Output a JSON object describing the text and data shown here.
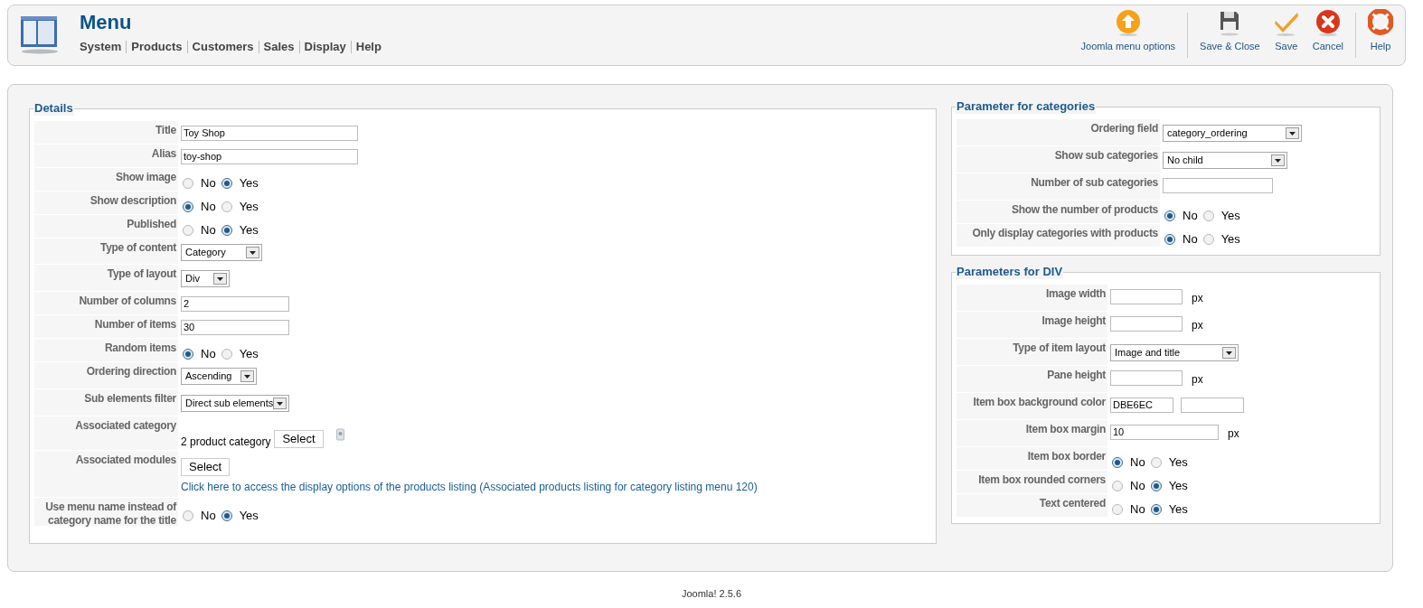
{
  "header": {
    "title": "Menu",
    "menu": [
      "System",
      "Products",
      "Customers",
      "Sales",
      "Display",
      "Help"
    ]
  },
  "toolbar": [
    {
      "kind": "options",
      "label": "Joomla menu options"
    },
    {
      "kind": "save-close",
      "label": "Save & Close"
    },
    {
      "kind": "save",
      "label": "Save"
    },
    {
      "kind": "cancel",
      "label": "Cancel"
    },
    {
      "kind": "help",
      "label": "Help"
    }
  ],
  "details": {
    "legend": "Details",
    "rows": [
      {
        "kind": "text",
        "label": "Title",
        "value": "Toy Shop"
      },
      {
        "kind": "text",
        "label": "Alias",
        "value": "toy-shop"
      },
      {
        "kind": "radio",
        "label": "Show image",
        "options": [
          {
            "label": "No",
            "selected": false
          },
          {
            "label": "Yes",
            "selected": true
          }
        ]
      },
      {
        "kind": "radio",
        "label": "Show description",
        "options": [
          {
            "label": "No",
            "selected": true
          },
          {
            "label": "Yes",
            "selected": false
          }
        ]
      },
      {
        "kind": "radio",
        "label": "Published",
        "options": [
          {
            "label": "No",
            "selected": false
          },
          {
            "label": "Yes",
            "selected": true
          }
        ]
      },
      {
        "kind": "select",
        "label": "Type of content",
        "value": "Category"
      },
      {
        "kind": "select",
        "label": "Type of layout",
        "value": "Div"
      },
      {
        "kind": "text",
        "label": "Number of columns",
        "value": "2"
      },
      {
        "kind": "text",
        "label": "Number of items",
        "value": "30"
      },
      {
        "kind": "radio",
        "label": "Random items",
        "options": [
          {
            "label": "No",
            "selected": true
          },
          {
            "label": "Yes",
            "selected": false
          }
        ]
      },
      {
        "kind": "select",
        "label": "Ordering direction",
        "value": "Ascending"
      },
      {
        "kind": "select",
        "label": "Sub elements filter",
        "value": "Direct sub elements"
      },
      {
        "kind": "category",
        "label": "Associated category",
        "value": "2 product category",
        "button": "Select"
      },
      {
        "kind": "modules",
        "label": "Associated modules",
        "button": "Select",
        "link": "Click here to access the display options of the products listing (Associated products listing for category listing menu 120)"
      },
      {
        "kind": "radio",
        "label": "Use menu name instead of category name for the title",
        "options": [
          {
            "label": "No",
            "selected": false
          },
          {
            "label": "Yes",
            "selected": true
          }
        ]
      }
    ]
  },
  "categories": {
    "legend": "Parameter for categories",
    "rows": [
      {
        "kind": "select",
        "label": "Ordering field",
        "value": "category_ordering"
      },
      {
        "kind": "select",
        "label": "Show sub categories",
        "value": "No child"
      },
      {
        "kind": "text",
        "label": "Number of sub categories"
      },
      {
        "kind": "radio",
        "label": "Show the number of products",
        "options": [
          {
            "label": "No",
            "selected": true
          },
          {
            "label": "Yes",
            "selected": false
          }
        ]
      },
      {
        "kind": "radio",
        "label": "Only display categories with products",
        "options": [
          {
            "label": "No",
            "selected": true
          },
          {
            "label": "Yes",
            "selected": false
          }
        ]
      }
    ]
  },
  "div": {
    "legend": "Parameters for DIV",
    "rows": [
      {
        "kind": "text",
        "label": "Image width",
        "unit": "px"
      },
      {
        "kind": "text",
        "label": "Image height",
        "unit": "px"
      },
      {
        "kind": "select",
        "label": "Type of item layout",
        "value": "Image and title"
      },
      {
        "kind": "text",
        "label": "Pane height",
        "unit": "px"
      },
      {
        "kind": "color",
        "label": "Item box background color",
        "value": "DBE6EC"
      },
      {
        "kind": "text",
        "label": "Item box margin",
        "value": "10",
        "unit": "px"
      },
      {
        "kind": "radio",
        "label": "Item box border",
        "options": [
          {
            "label": "No",
            "selected": true
          },
          {
            "label": "Yes",
            "selected": false
          }
        ]
      },
      {
        "kind": "radio",
        "label": "Item box rounded corners",
        "options": [
          {
            "label": "No",
            "selected": false
          },
          {
            "label": "Yes",
            "selected": true
          }
        ]
      },
      {
        "kind": "radio",
        "label": "Text centered",
        "options": [
          {
            "label": "No",
            "selected": false
          },
          {
            "label": "Yes",
            "selected": true
          }
        ]
      }
    ]
  },
  "footer": "Joomla! 2.5.6"
}
